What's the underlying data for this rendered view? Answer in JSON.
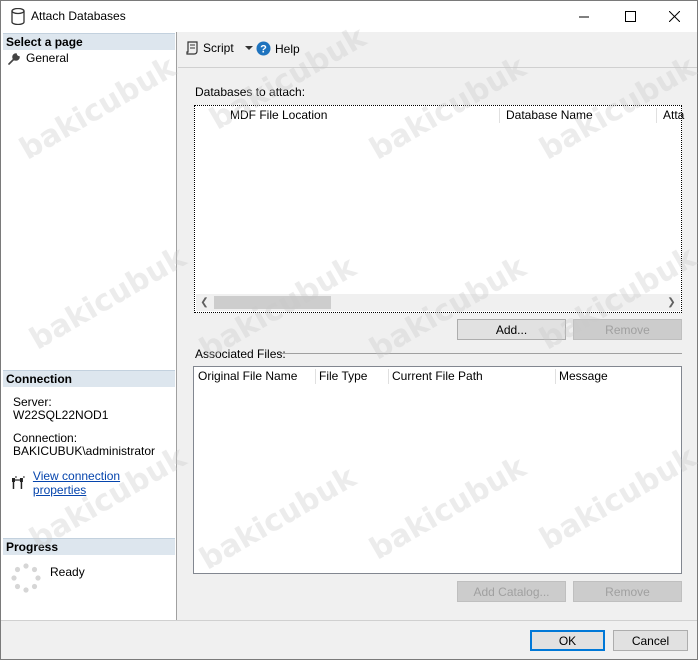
{
  "window": {
    "title": "Attach Databases",
    "icon": "database-icon",
    "controls": [
      "minimize-icon",
      "maximize-icon",
      "close-icon"
    ]
  },
  "sidebar": {
    "select_page_header": "Select a page",
    "pages": [
      {
        "label": "General",
        "icon": "wrench-icon"
      }
    ],
    "connection_header": "Connection",
    "server_label": "Server:",
    "server_value": "W22SQL22NOD1",
    "connection_label": "Connection:",
    "connection_value": "BAKICUBUK\\administrator",
    "view_connection_link": "View connection properties",
    "progress_header": "Progress",
    "progress_status": "Ready"
  },
  "toolbar": {
    "script_label": "Script",
    "help_label": "Help"
  },
  "databases_section": {
    "label": "Databases to attach:",
    "columns": [
      "MDF File Location",
      "Database Name",
      "Atta"
    ],
    "rows": [],
    "add_button": "Add...",
    "remove_button": "Remove"
  },
  "associated_section": {
    "label": "Associated Files:",
    "columns": [
      "Original File Name",
      "File Type",
      "Current File Path",
      "Message"
    ],
    "rows": [],
    "add_catalog_button": "Add Catalog...",
    "remove_button": "Remove"
  },
  "footer": {
    "ok_button": "OK",
    "cancel_button": "Cancel"
  },
  "watermark_text": "bakicubuk",
  "colors": {
    "accent": "#0078d7",
    "section_header_bg": "#dde6ee",
    "link": "#0645ad"
  }
}
